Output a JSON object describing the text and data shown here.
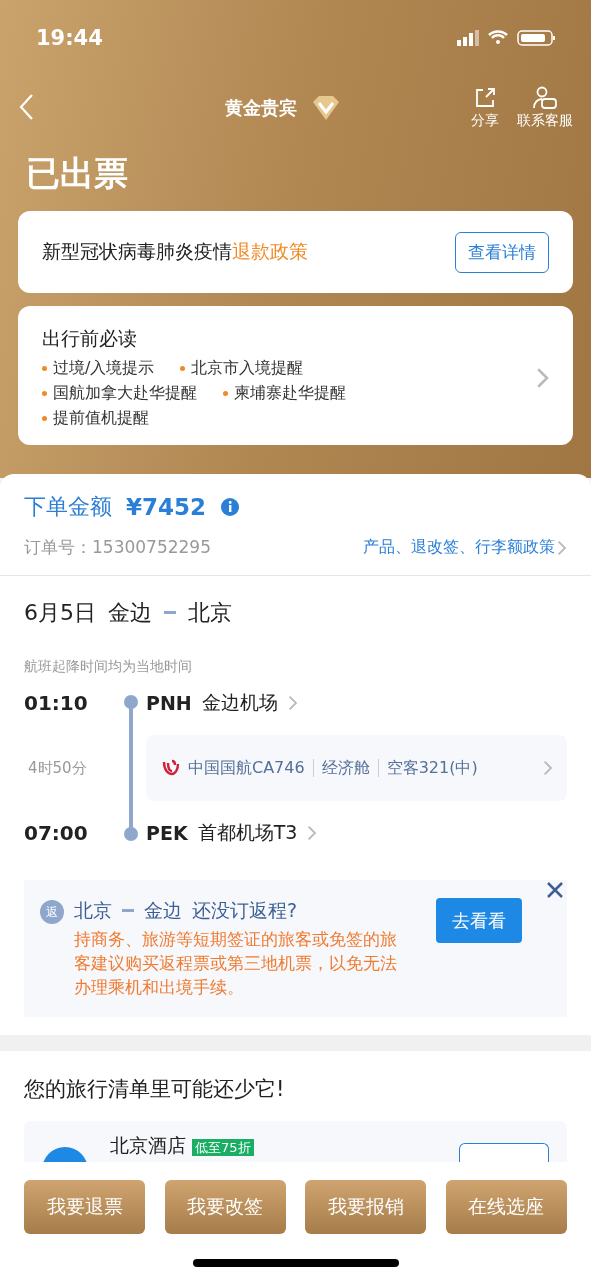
{
  "status_bar": {
    "time": "19:44"
  },
  "nav": {
    "title": "黄金贵宾",
    "actions": [
      {
        "label": "分享",
        "kind": "share"
      },
      {
        "label": "联系客服",
        "kind": "service"
      }
    ]
  },
  "status_title": "已出票",
  "policy_card": {
    "text": "新型冠状病毒肺炎疫情",
    "link": "退款政策",
    "button": "查看详情"
  },
  "notice_card": {
    "title": "出行前必读",
    "items": [
      "过境/入境提示",
      "北京市入境提醒",
      "国航加拿大赴华提醒",
      "柬埔寨赴华提醒",
      "提前值机提醒"
    ]
  },
  "order": {
    "amount_label": "下单金额",
    "amount": "¥7452",
    "number_label": "订单号：",
    "number": "15300752295",
    "policy_link": "产品、退改签、行李额政策"
  },
  "trip": {
    "date": "6月5日",
    "from": "金边",
    "to": "北京",
    "note": "航班起降时间均为当地时间",
    "departure": {
      "time": "01:10",
      "code": "PNH",
      "airport": "金边机场"
    },
    "duration": "4时50分",
    "flight": {
      "airline": "中国国航CA746",
      "cabin": "经济舱",
      "aircraft": "空客321(中)"
    },
    "arrival": {
      "time": "07:00",
      "code": "PEK",
      "airport": "首都机场T3"
    }
  },
  "return_tip": {
    "badge": "返",
    "from": "北京",
    "to": "金边",
    "question": "还没订返程?",
    "body": "持商务、旅游等短期签证的旅客或免签的旅客建议购买返程票或第三地机票，以免无法办理乘机和出境手续。",
    "button": "去看看"
  },
  "suggestions": {
    "title": "您的旅行清单里可能还少它!",
    "items": [
      {
        "name": "北京酒店",
        "tag": "低至75折"
      }
    ]
  },
  "bottom_buttons": [
    "我要退票",
    "我要改签",
    "我要报销",
    "在线选座"
  ]
}
